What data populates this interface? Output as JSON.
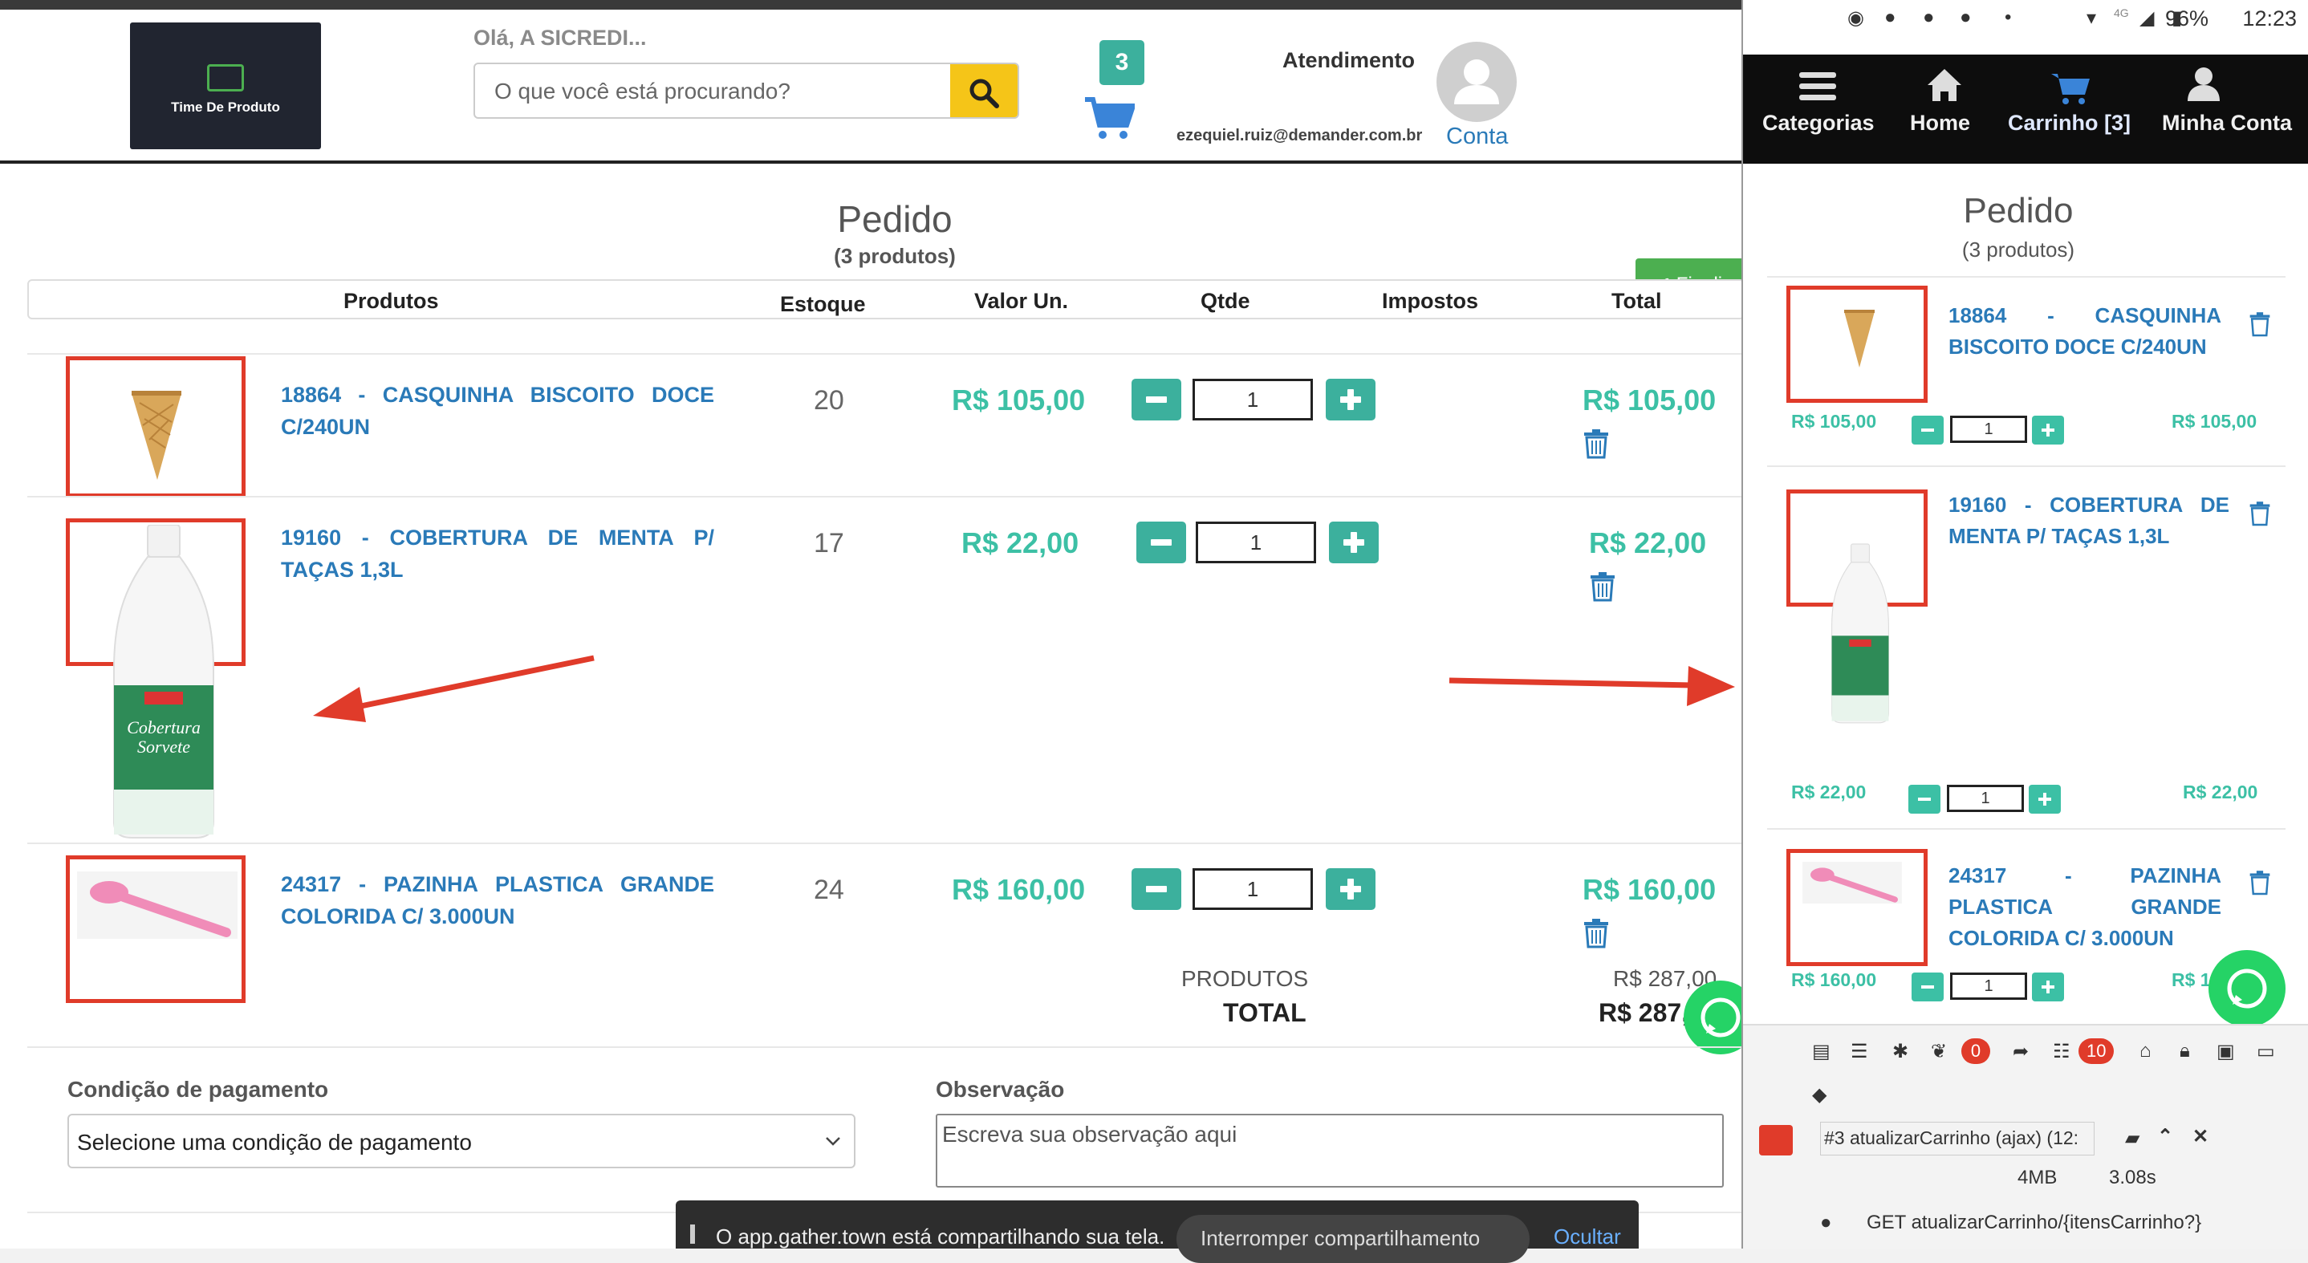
{
  "header": {
    "logo_text": "Time De Produto",
    "greeting": "Olá, A SICREDI...",
    "search_placeholder": "O que você está procurando?",
    "cart_count": "3",
    "support_label": "Atendimento",
    "email": "ezequiel.ruiz@demander.com.br",
    "account_label": "Conta"
  },
  "order": {
    "title": "Pedido",
    "count_label": "(3 produtos)",
    "finalize_label": "✔ Finaliza",
    "columns": {
      "products": "Produtos",
      "stock": "Estoque",
      "unit_price": "Valor Un.",
      "qty": "Qtde",
      "taxes": "Impostos",
      "total": "Total"
    },
    "items": [
      {
        "name": "18864 - CASQUINHA BISCOITO DOCE C/240UN",
        "stock": "20",
        "unit_price": "R$ 105,00",
        "qty": "1",
        "total": "R$ 105,00"
      },
      {
        "name": "19160 - COBERTURA DE MENTA P/ TAÇAS 1,3L",
        "stock": "17",
        "unit_price": "R$ 22,00",
        "qty": "1",
        "total": "R$ 22,00"
      },
      {
        "name": "24317 - PAZINHA PLASTICA GRANDE COLORIDA C/ 3.000UN",
        "stock": "24",
        "unit_price": "R$ 160,00",
        "qty": "1",
        "total": "R$ 160,00"
      }
    ],
    "summary": {
      "products_label": "PRODUTOS",
      "products_value": "R$ 287,00",
      "total_label": "TOTAL",
      "total_value": "R$ 287,"
    }
  },
  "form": {
    "payment_label": "Condição de pagamento",
    "payment_value": "Selecione uma condição de pagamento",
    "notes_label": "Observação",
    "notes_placeholder": "Escreva sua observação aqui"
  },
  "share_bar": {
    "message": "O app.gather.town está compartilhando sua tela.",
    "stop_label": "Interromper compartilhamento",
    "hide_label": "Ocultar"
  },
  "mobile": {
    "status": {
      "battery": "96%",
      "time": "12:23",
      "network": "4G"
    },
    "nav": [
      "Categorias",
      "Home",
      "Carrinho [3]",
      "Minha Conta"
    ],
    "title": "Pedido",
    "count_label": "(3 produtos)",
    "items": [
      {
        "name": "18864 - CASQUINHA BISCOITO DOCE C/240UN",
        "unit_price": "R$ 105,00",
        "qty": "1",
        "total": "R$ 105,00"
      },
      {
        "name": "19160 - COBERTURA DE MENTA P/ TAÇAS 1,3L",
        "unit_price": "R$ 22,00",
        "qty": "1",
        "total": "R$ 22,00"
      },
      {
        "name": "24317 - PAZINHA PLASTICA GRANDE COLORIDA C/ 3.000UN",
        "unit_price": "R$ 160,00",
        "qty": "1",
        "total": "R$ 160"
      }
    ],
    "debug": {
      "badge_a": "0",
      "badge_b": "10",
      "request": "#3 atualizarCarrinho (ajax) (12:",
      "memory": "4MB",
      "duration": "3.08s",
      "route": "GET atualizarCarrinho/{itensCarrinho?}"
    }
  },
  "colors": {
    "accent": "#3cb09d",
    "link": "#2a7ab8",
    "highlight": "#e03b2a",
    "search_button": "#f5c518"
  }
}
